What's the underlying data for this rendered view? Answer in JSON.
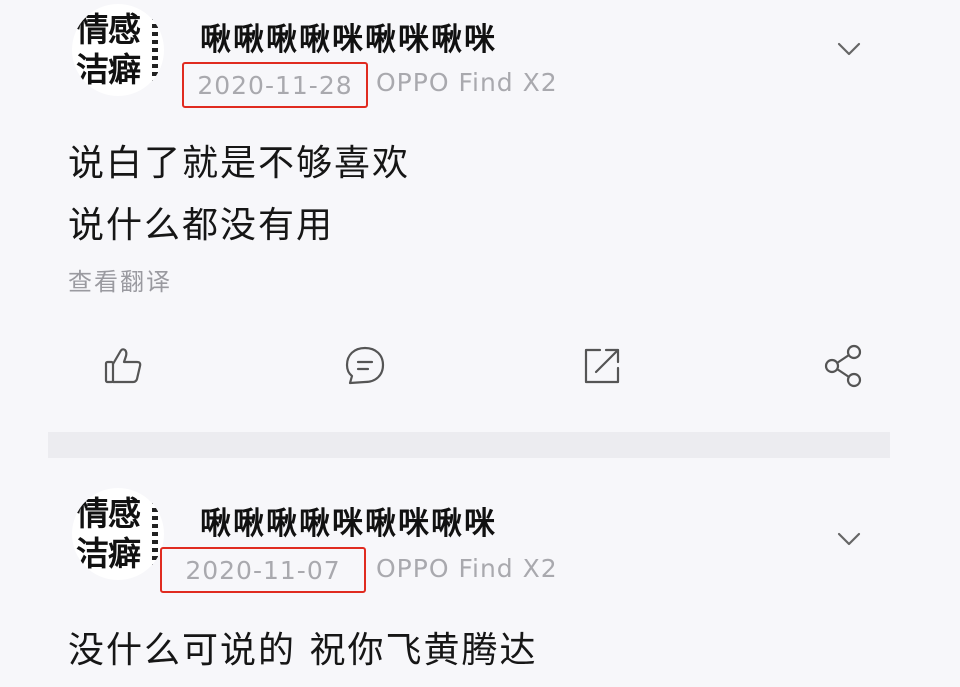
{
  "posts": [
    {
      "username": "啾啾啾啾咪啾咪啾咪",
      "avatar_text": [
        "情感",
        "洁癖"
      ],
      "date": "2020-11-28",
      "device": "OPPO Find X2",
      "content_lines": [
        "说白了就是不够喜欢",
        "说什么都没有用"
      ],
      "translate_label": "查看翻译"
    },
    {
      "username": "啾啾啾啾咪啾咪啾咪",
      "avatar_text": [
        "情感",
        "洁癖"
      ],
      "date": "2020-11-07",
      "device": "OPPO Find X2",
      "content_lines": [
        "没什么可说的 祝你飞黄腾达"
      ]
    }
  ],
  "actions": [
    {
      "icon": "thumbs-up-icon"
    },
    {
      "icon": "comment-icon"
    },
    {
      "icon": "forward-icon"
    },
    {
      "icon": "share-icon"
    }
  ],
  "colors": {
    "background": "#f7f7fa",
    "highlight_box": "#e02b20",
    "meta_text": "#a9a9ae",
    "icon_stroke": "#555555"
  }
}
